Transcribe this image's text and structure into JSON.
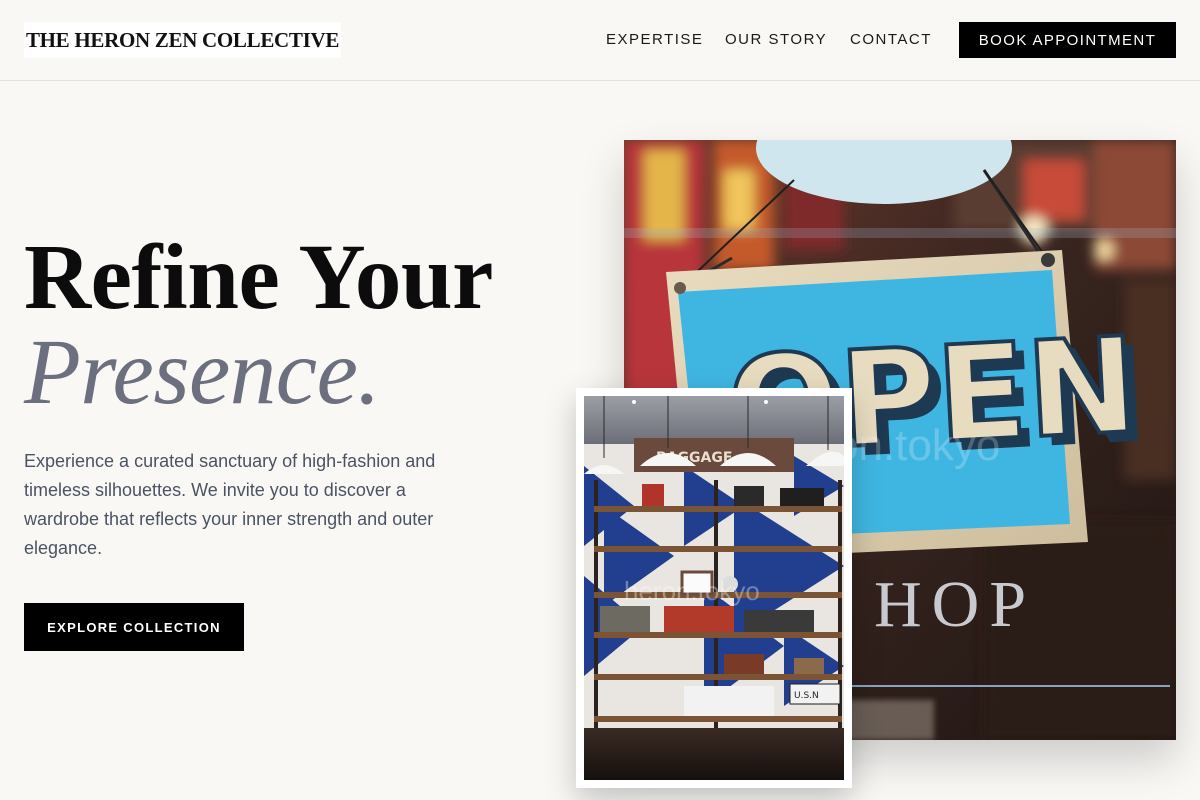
{
  "brand": {
    "name": "THE HERON ZEN COLLECTIVE"
  },
  "nav": {
    "items": [
      {
        "label": "EXPERTISE"
      },
      {
        "label": "OUR STORY"
      },
      {
        "label": "CONTACT"
      }
    ],
    "cta_label": "BOOK APPOINTMENT"
  },
  "hero": {
    "title_line1": "Refine Your",
    "title_line2": "Presence.",
    "description": "Experience a curated sanctuary of high-fashion and timeless silhouettes. We invite you to discover a wardrobe that reflects your inner strength and outer elegance.",
    "cta_label": "EXPLORE COLLECTION"
  },
  "images": {
    "main": {
      "description_icon": "open-sign-photo",
      "sign_text": "OPEN",
      "window_text": "HOP"
    },
    "secondary": {
      "description_icon": "shop-interior-photo"
    }
  },
  "theme": {
    "background": "#f9f8f5",
    "accent": "#000000",
    "muted_heading": "#6b6f7e",
    "body_text": "#4b5363"
  }
}
